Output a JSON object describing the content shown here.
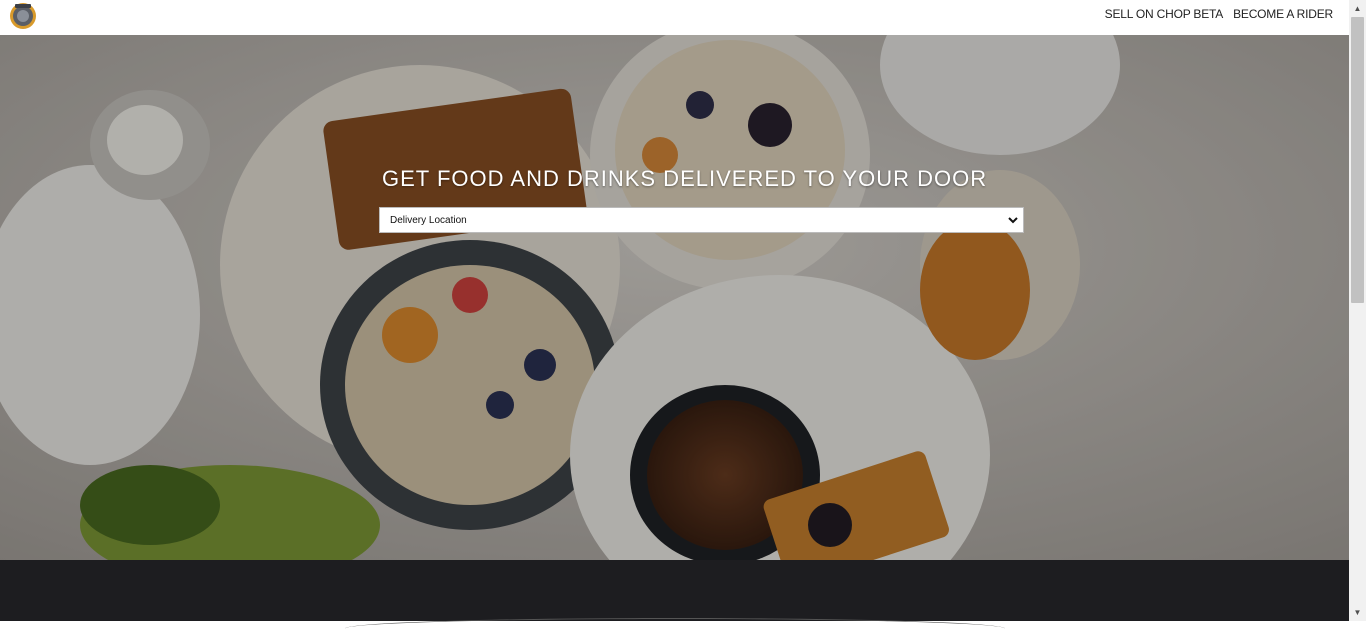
{
  "nav": {
    "sell_label": "SELL ON CHOP BETA",
    "rider_label": "BECOME A RIDER"
  },
  "hero": {
    "headline": "GET FOOD AND DRINKS DELIVERED TO YOUR DOOR",
    "location_select": {
      "selected": "Delivery Location"
    }
  },
  "scrollbar": {
    "up_glyph": "▲",
    "down_glyph": "▼"
  },
  "icons": {
    "logo": "chop-logo",
    "dropdown": "chevron-down-icon"
  },
  "colors": {
    "footer_bg": "#1d1d20",
    "headline": "#ffffff"
  }
}
